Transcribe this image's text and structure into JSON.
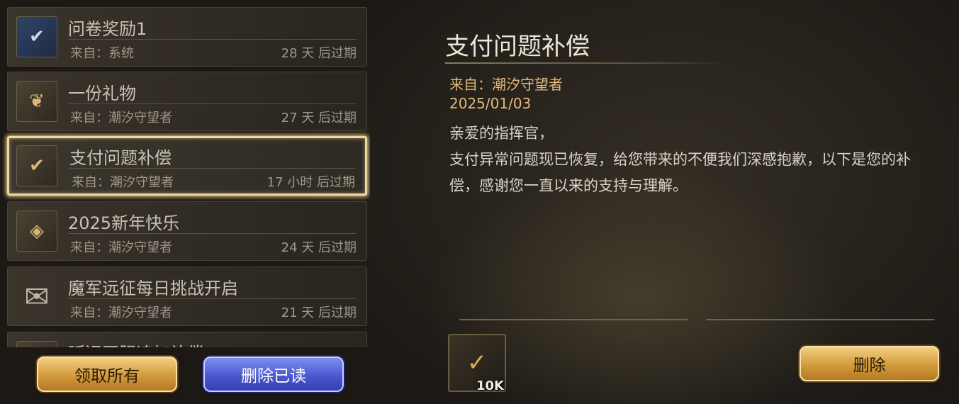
{
  "mails": [
    {
      "title": "问卷奖励1",
      "from": "来自：系统",
      "expire": "28 天 后过期",
      "icon": "shield-check-icon",
      "selected": false
    },
    {
      "title": "一份礼物",
      "from": "来自：潮汐守望者",
      "expire": "27 天 后过期",
      "icon": "gift-scroll-icon",
      "selected": false
    },
    {
      "title": "支付问题补偿",
      "from": "来自：潮汐守望者",
      "expire": "17 小时 后过期",
      "icon": "shield-check-icon",
      "selected": true
    },
    {
      "title": "2025新年快乐",
      "from": "来自：潮汐守望者",
      "expire": "24 天 后过期",
      "icon": "badge-icon",
      "selected": false
    },
    {
      "title": "魔军远征每日挑战开启",
      "from": "来自：潮汐守望者",
      "expire": "21 天 后过期",
      "icon": "envelope-icon",
      "selected": false
    },
    {
      "title": "延迟开服追加补偿",
      "from": "",
      "expire": "",
      "icon": "shield-check-icon",
      "selected": false
    }
  ],
  "buttons": {
    "claim_all": "领取所有",
    "delete_read": "删除已读",
    "delete": "删除"
  },
  "detail": {
    "title": "支付问题补偿",
    "from": "来自：潮汐守望者",
    "date": "2025/01/03",
    "greeting": "亲爱的指挥官，",
    "body": "支付异常问题现已恢复，给您带来的不便我们深感抱歉，以下是您的补偿，感谢您一直以来的支持与理解。",
    "reward": {
      "icon": "card-check-icon",
      "count": "10K"
    }
  },
  "colors": {
    "accent_gold": "#e2b978",
    "selected_border": "#f0d7a0",
    "button_blue": "#4c57d2",
    "button_gold": "#d39a3c"
  }
}
